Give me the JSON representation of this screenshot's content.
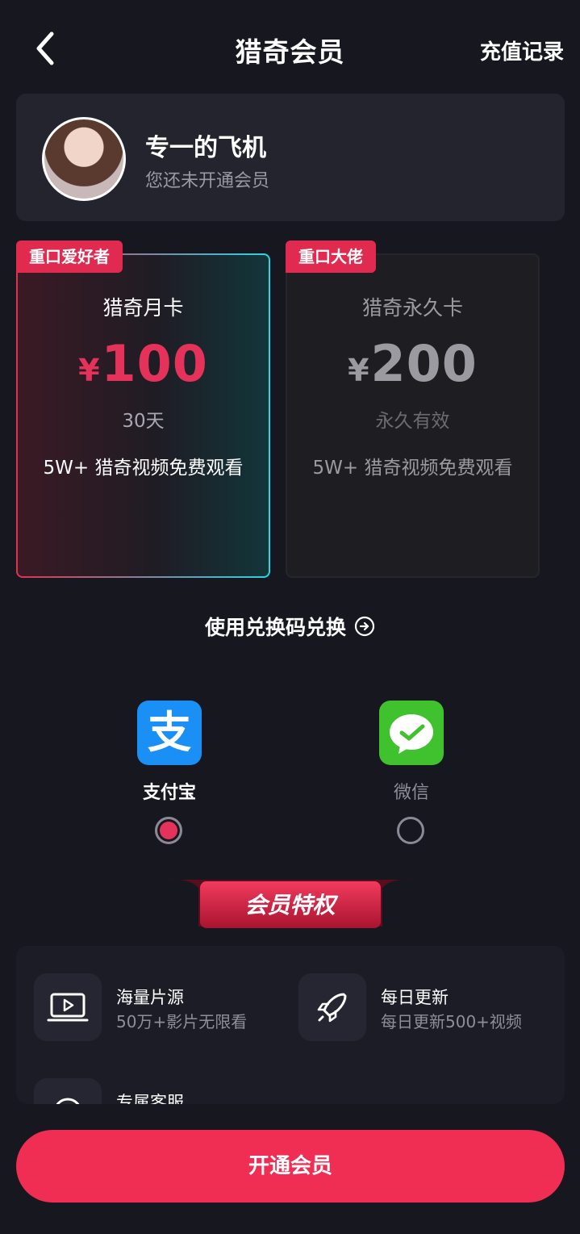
{
  "header": {
    "title": "猎奇会员",
    "history_label": "充值记录"
  },
  "user": {
    "name": "专一的飞机",
    "status": "您还未开通会员"
  },
  "plans": [
    {
      "tag": "重口爱好者",
      "name": "猎奇月卡",
      "currency": "¥",
      "price": "100",
      "duration": "30天",
      "desc": "5W+ 猎奇视频免费观看",
      "selected": true
    },
    {
      "tag": "重口大佬",
      "name": "猎奇永久卡",
      "currency": "¥",
      "price": "200",
      "duration": "永久有效",
      "desc": "5W+ 猎奇视频免费观看",
      "selected": false
    }
  ],
  "redeem": {
    "label": "使用兑换码兑换"
  },
  "payment": {
    "options": [
      {
        "label": "支付宝",
        "icon": "alipay-icon",
        "selected": true
      },
      {
        "label": "微信",
        "icon": "wechat-icon",
        "selected": false
      }
    ]
  },
  "privileges": {
    "title": "会员特权",
    "items": [
      {
        "name": "海量片源",
        "desc": "50万+影片无限看",
        "icon": "video-screen-icon"
      },
      {
        "name": "每日更新",
        "desc": "每日更新500+视频",
        "icon": "rocket-icon"
      },
      {
        "name": "专属客服",
        "desc": "",
        "icon": "headset-icon"
      }
    ]
  },
  "cta": {
    "label": "开通会员"
  },
  "colors": {
    "background": "#17171f",
    "accent": "#f02e54",
    "alipay": "#1a8ff5",
    "wechat": "#3fc22e"
  }
}
